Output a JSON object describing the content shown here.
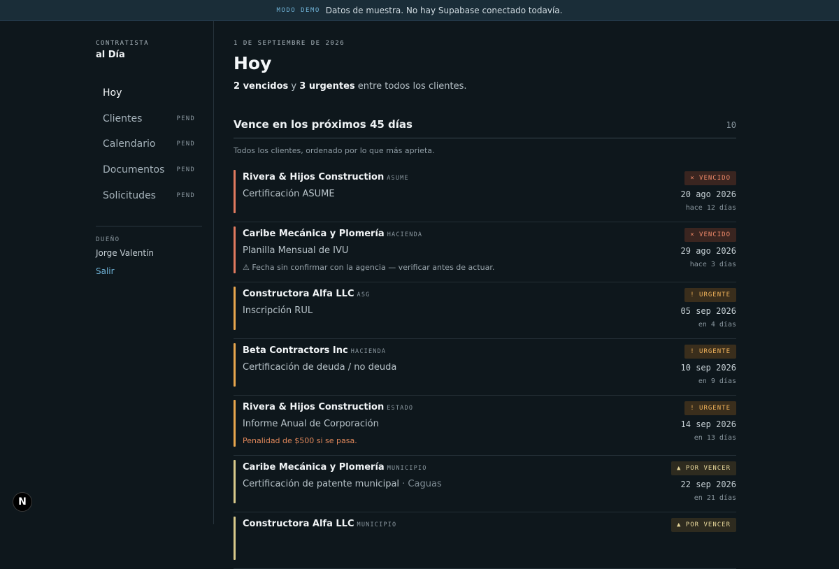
{
  "banner": {
    "tag": "MODO DEMO",
    "message": "Datos de muestra. No hay Supabase conectado todavía."
  },
  "sidebar": {
    "brand_small": "CONTRATISTA",
    "brand_big": "al Día",
    "items": [
      {
        "label": "Hoy",
        "badge": ""
      },
      {
        "label": "Clientes",
        "badge": "PEND"
      },
      {
        "label": "Calendario",
        "badge": "PEND"
      },
      {
        "label": "Documentos",
        "badge": "PEND"
      },
      {
        "label": "Solicitudes",
        "badge": "PEND"
      }
    ],
    "owner_label": "DUEÑO",
    "owner_name": "Jorge Valentín",
    "logout": "Salir"
  },
  "main": {
    "date": "1 DE SEPTIEMBRE DE 2026",
    "title": "Hoy",
    "summary": {
      "overdue_count": "2 vencidos",
      "joiner": "y",
      "urgent_count": "3 urgentes",
      "tail": "entre todos los clientes."
    },
    "section": {
      "title": "Vence en los próximos 45 días",
      "count": "10",
      "subtitle": "Todos los clientes, ordenado por lo que más aprieta."
    },
    "rows": [
      {
        "client": "Rivera & Hijos Construction",
        "agency": "ASUME",
        "item": "Certificación ASUME",
        "muni": "",
        "note": "",
        "note_kind": "",
        "status": "vencido",
        "badge": "× VENCIDO",
        "due": "20 ago 2026",
        "relative": "hace 12 días"
      },
      {
        "client": "Caribe Mecánica y Plomería",
        "agency": "HACIENDA",
        "item": "Planilla Mensual de IVU",
        "muni": "",
        "note": "⚠ Fecha sin confirmar con la agencia — verificar antes de actuar.",
        "note_kind": "warn",
        "status": "vencido",
        "badge": "× VENCIDO",
        "due": "29 ago 2026",
        "relative": "hace 3 días"
      },
      {
        "client": "Constructora Alfa LLC",
        "agency": "ASG",
        "item": "Inscripción RUL",
        "muni": "",
        "note": "",
        "note_kind": "",
        "status": "urgente",
        "badge": "! URGENTE",
        "due": "05 sep 2026",
        "relative": "en 4 días"
      },
      {
        "client": "Beta Contractors Inc",
        "agency": "HACIENDA",
        "item": "Certificación de deuda / no deuda",
        "muni": "",
        "note": "",
        "note_kind": "",
        "status": "urgente",
        "badge": "! URGENTE",
        "due": "10 sep 2026",
        "relative": "en 9 días"
      },
      {
        "client": "Rivera & Hijos Construction",
        "agency": "ESTADO",
        "item": "Informe Anual de Corporación",
        "muni": "",
        "note": "Penalidad de $500 si se pasa.",
        "note_kind": "penalty",
        "status": "urgente",
        "badge": "! URGENTE",
        "due": "14 sep 2026",
        "relative": "en 13 días"
      },
      {
        "client": "Caribe Mecánica y Plomería",
        "agency": "MUNICIPIO",
        "item": "Certificación de patente municipal",
        "muni": "· Caguas",
        "note": "",
        "note_kind": "",
        "status": "porvencer",
        "badge": "▲ POR VENCER",
        "due": "22 sep 2026",
        "relative": "en 21 días"
      },
      {
        "client": "Constructora Alfa LLC",
        "agency": "MUNICIPIO",
        "item": "",
        "muni": "",
        "note": "",
        "note_kind": "",
        "status": "porvencer",
        "badge": "▲ POR VENCER",
        "due": "",
        "relative": ""
      }
    ]
  },
  "colors": {
    "vencido": "#e07a5f",
    "urgente": "#e8a64d",
    "porvencer": "#d8c98a",
    "link": "#6fb2d6",
    "penalty": "#e0875a"
  },
  "icons": {
    "framework_logo": "N"
  }
}
